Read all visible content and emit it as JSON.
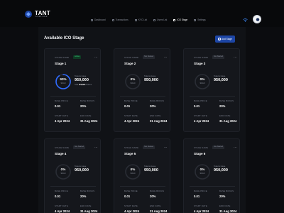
{
  "app": {
    "logo_title": "TANT",
    "logo_sub": "TOKEN SALE"
  },
  "nav": [
    {
      "label": "Dashboard",
      "active": false
    },
    {
      "label": "Transactions",
      "active": false
    },
    {
      "label": "KYC List",
      "active": false
    },
    {
      "label": "Users List",
      "active": false
    },
    {
      "label": "ICO Stage",
      "active": true
    },
    {
      "label": "Settings",
      "active": false
    }
  ],
  "page": {
    "title": "Available ICO Stage",
    "add_button": "Add Stage"
  },
  "labels": {
    "stage_name": "STAGE NAME",
    "tokens_issue": "Tokens Issue",
    "base_price": "BASE PRICE",
    "base_bonus": "BASE BONUS",
    "start_date": "START DATE",
    "end_date": "END DATE",
    "sold": "SOLD"
  },
  "colors": {
    "accent": "#1d46a6",
    "ring_active": "#2f6bff",
    "ring_track": "#2a2d35",
    "badge_active": "#3ddc84"
  },
  "stages": [
    {
      "name": "Stage 1",
      "status": "Active",
      "status_type": "active",
      "percent": 90,
      "percent_label": "90%",
      "tokens": "950,000",
      "sold_label": "Sold",
      "sold_value": "972,694",
      "sold_suffix": "Tokens",
      "base_price": "0.01",
      "base_bonus": "20%",
      "start_date": "4 Apr 2024",
      "end_date": "31 Aug 2024"
    },
    {
      "name": "Stage 2",
      "status": "Not Started",
      "status_type": "notstarted",
      "percent": 0,
      "percent_label": "0%",
      "tokens": "950,000",
      "base_price": "0.01",
      "base_bonus": "20%",
      "start_date": "4 Apr 2024",
      "end_date": "31 Aug 2024"
    },
    {
      "name": "Stage 3",
      "status": "Not Started",
      "status_type": "notstarted",
      "percent": 0,
      "percent_label": "0%",
      "tokens": "950,000",
      "base_price": "0.01",
      "base_bonus": "20%",
      "start_date": "4 Apr 2024",
      "end_date": "31 Aug 2024"
    },
    {
      "name": "Stage 4",
      "status": "Not Started",
      "status_type": "notstarted",
      "percent": 0,
      "percent_label": "0%",
      "tokens": "950,000",
      "base_price": "0.01",
      "base_bonus": "20%",
      "start_date": "4 Apr 2024",
      "end_date": "31 Aug 2024"
    },
    {
      "name": "Stage 5",
      "status": "Not Started",
      "status_type": "notstarted",
      "percent": 0,
      "percent_label": "0%",
      "tokens": "950,000",
      "base_price": "0.01",
      "base_bonus": "20%",
      "start_date": "4 Apr 2024",
      "end_date": "31 Aug 2024"
    },
    {
      "name": "Stage 6",
      "status": "Not Started",
      "status_type": "notstarted",
      "percent": 0,
      "percent_label": "0%",
      "tokens": "950,000",
      "base_price": "0.01",
      "base_bonus": "20%",
      "start_date": "4 Apr 2024",
      "end_date": "31 Aug 2024"
    }
  ]
}
